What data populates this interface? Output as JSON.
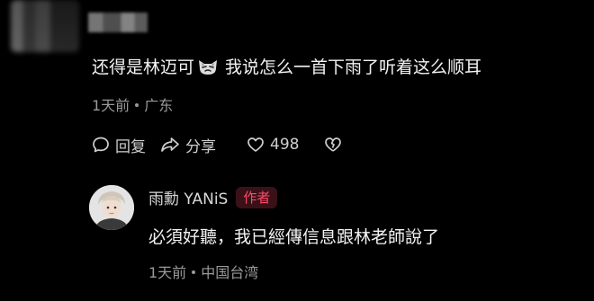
{
  "top_comment": {
    "text_before_emoji": "还得是林迈可",
    "emoji": "cat-emoji",
    "text_after_emoji": "我说怎么一首下雨了听着这么顺耳",
    "time": "1天前",
    "location": "广东"
  },
  "actions": {
    "reply_label": "回复",
    "share_label": "分享",
    "like_count": "498"
  },
  "reply": {
    "author": "雨勳 YANiS",
    "badge": "作者",
    "text": "必須好聽，我已經傳信息跟林老師說了",
    "time": "1天前",
    "location": "中国台湾"
  },
  "colors": {
    "background": "#000000",
    "badge_text": "#ff4b6a",
    "badge_bg": "#3b1118",
    "meta_text": "#9a9a9a"
  }
}
